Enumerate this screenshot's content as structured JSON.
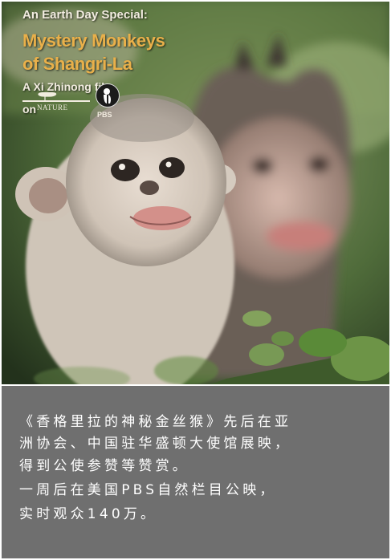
{
  "poster": {
    "line1": "An Earth Day Special:",
    "line2": "Mystery Monkeys",
    "line3": "of Shangri-La",
    "line4": "A Xi Zhinong film",
    "line5": "on",
    "nature_label": "NATURE",
    "pbs_label": "PBS",
    "title_color": "#e9b04a"
  },
  "caption": {
    "lines": [
      "《香格里拉的神秘金丝猴》先后在亚",
      "洲协会、中国驻华盛顿大使馆展映，",
      "得到公使参赞等赞赏。",
      "一周后在美国PBS自然栏目公映，",
      "实时观众140万。"
    ],
    "background": "#6f6f6f"
  }
}
